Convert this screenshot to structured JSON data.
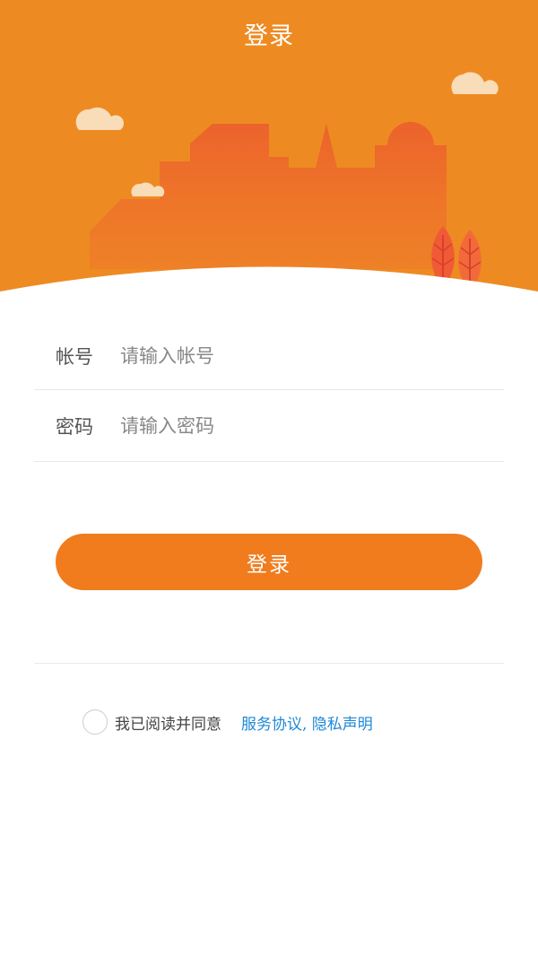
{
  "header": {
    "title": "登录"
  },
  "form": {
    "account": {
      "label": "帐号",
      "placeholder": "请输入帐号",
      "value": ""
    },
    "password": {
      "label": "密码",
      "placeholder": "请输入密码",
      "value": ""
    }
  },
  "login_button": {
    "label": "登录"
  },
  "agreement": {
    "checked": false,
    "text": "我已阅读并同意",
    "link_text": "服务协议, 隐私声明"
  },
  "colors": {
    "header_bg": "#ee8a22",
    "buildings": "#ec6a2c",
    "button": "#f07c1e",
    "link": "#1e88d6"
  }
}
